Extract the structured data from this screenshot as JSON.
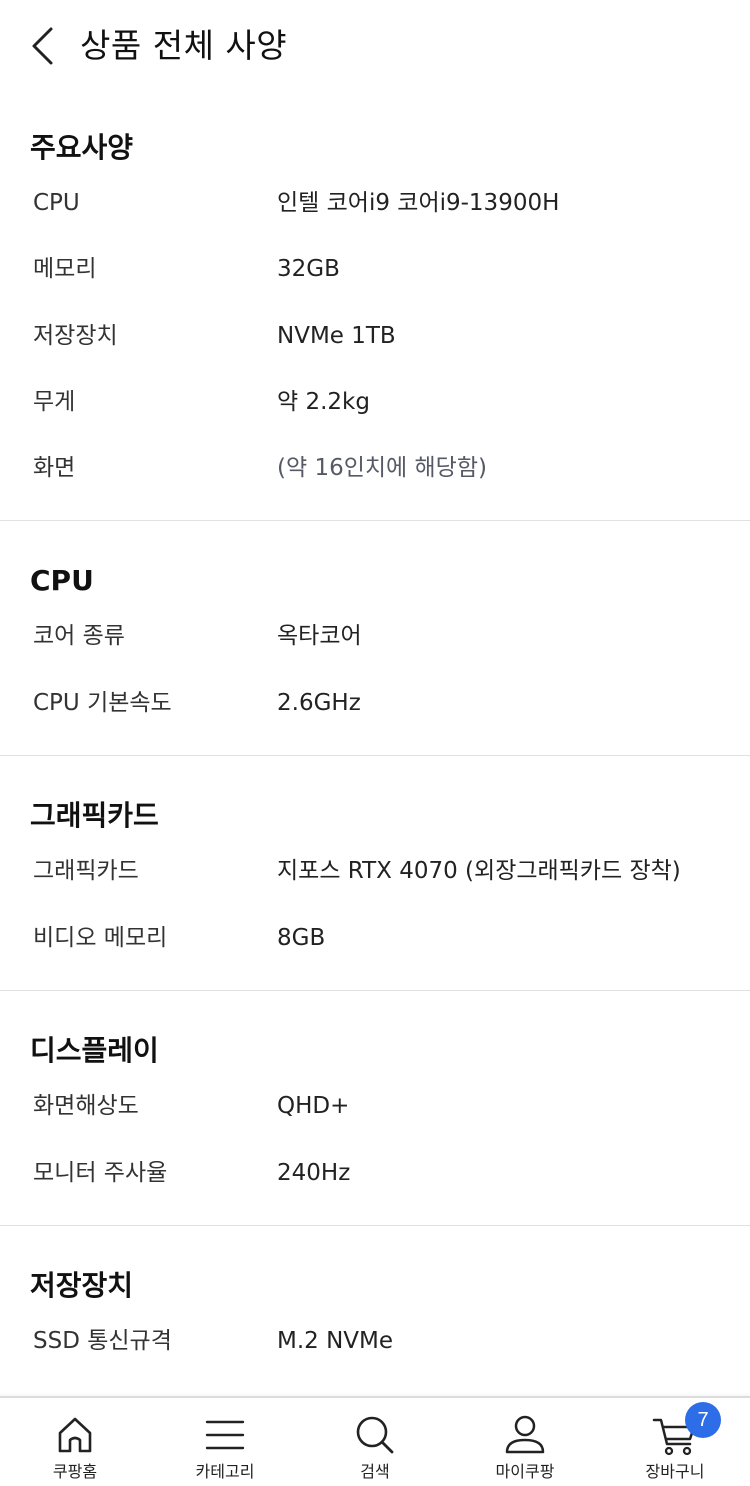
{
  "header": {
    "title": "상품 전체 사양",
    "back_icon": "chevron-left-icon"
  },
  "sections": [
    {
      "title": "주요사양",
      "rows": [
        {
          "label": "CPU",
          "value": "인텔 코어i9 코어i9-13900H"
        },
        {
          "label": "메모리",
          "value": "32GB"
        },
        {
          "label": "저장장치",
          "value": "NVMe 1TB"
        },
        {
          "label": "무게",
          "value": "약 2.2kg"
        },
        {
          "label": "화면",
          "value": "(약 16인치에 해당함)"
        }
      ]
    },
    {
      "title": "CPU",
      "rows": [
        {
          "label": "코어 종류",
          "value": "옥타코어"
        },
        {
          "label": "CPU 기본속도",
          "value": "2.6GHz"
        }
      ]
    },
    {
      "title": "그래픽카드",
      "rows": [
        {
          "label": "그래픽카드",
          "value": "지포스 RTX 4070 (외장그래픽카드 장착)"
        },
        {
          "label": "비디오 메모리",
          "value": "8GB"
        }
      ]
    },
    {
      "title": "디스플레이",
      "rows": [
        {
          "label": "화면해상도",
          "value": "QHD+"
        },
        {
          "label": "모니터 주사율",
          "value": "240Hz"
        }
      ]
    },
    {
      "title": "저장장치",
      "rows": [
        {
          "label": "SSD 통신규격",
          "value": "M.2 NVMe"
        }
      ]
    }
  ],
  "bottom_nav": {
    "items": [
      {
        "label": "쿠팡홈",
        "icon": "home-icon"
      },
      {
        "label": "카테고리",
        "icon": "menu-icon"
      },
      {
        "label": "검색",
        "icon": "search-icon"
      },
      {
        "label": "마이쿠팡",
        "icon": "user-icon"
      },
      {
        "label": "장바구니",
        "icon": "cart-icon"
      }
    ],
    "cart_count": "7"
  },
  "colors": {
    "accent": "#2d6de8",
    "divider": "#e1e1e1",
    "text": "#111111"
  }
}
